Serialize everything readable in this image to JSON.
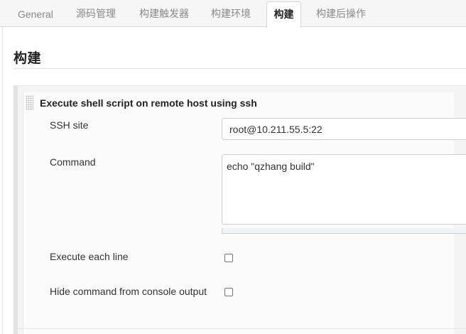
{
  "tabs": [
    {
      "label": "General",
      "active": false
    },
    {
      "label": "源码管理",
      "active": false
    },
    {
      "label": "构建触发器",
      "active": false
    },
    {
      "label": "构建环境",
      "active": false
    },
    {
      "label": "构建",
      "active": true
    },
    {
      "label": "构建后操作",
      "active": false
    }
  ],
  "section": {
    "title": "构建"
  },
  "build_step": {
    "title": "Execute shell script on remote host using ssh",
    "grip_icon": "drag-handle-icon",
    "ssh_site": {
      "label": "SSH site",
      "value": "root@10.211.55.5:22"
    },
    "command": {
      "label": "Command",
      "value": "echo \"qzhang build\""
    },
    "execute_each_line": {
      "label": "Execute each line",
      "checked": false
    },
    "hide_command": {
      "label": "Hide command from console output",
      "checked": false
    }
  }
}
